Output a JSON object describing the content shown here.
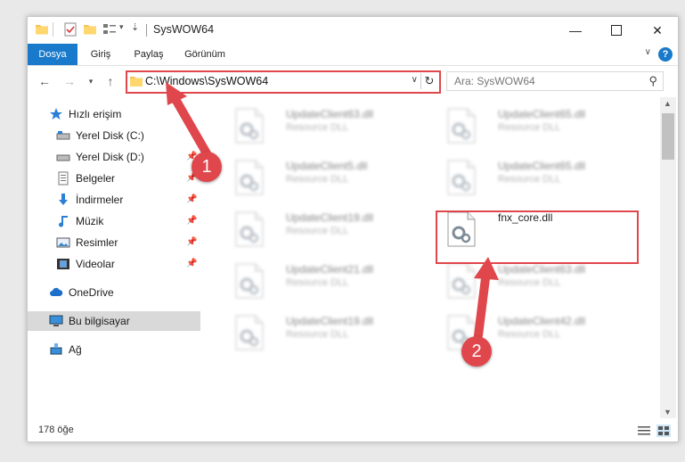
{
  "window": {
    "title": "SysWOW64"
  },
  "ribbon": {
    "tabs": [
      "Dosya",
      "Giriş",
      "Paylaş",
      "Görünüm"
    ],
    "help": "?"
  },
  "address": {
    "path": "C:\\Windows\\SysWOW64"
  },
  "search": {
    "placeholder": "Ara: SysWOW64"
  },
  "sidebar": {
    "items": [
      {
        "label": "Hızlı erişim",
        "icon": "star-icon"
      },
      {
        "label": "Yerel Disk (C:)",
        "icon": "drive-icon"
      },
      {
        "label": "Yerel Disk (D:)",
        "icon": "drive-icon"
      },
      {
        "label": "Belgeler",
        "icon": "documents-icon"
      },
      {
        "label": "İndirmeler",
        "icon": "download-icon"
      },
      {
        "label": "Müzik",
        "icon": "music-icon"
      },
      {
        "label": "Resimler",
        "icon": "pictures-icon"
      },
      {
        "label": "Videolar",
        "icon": "video-icon"
      },
      {
        "label": "OneDrive",
        "icon": "cloud-icon"
      },
      {
        "label": "Bu bilgisayar",
        "icon": "computer-icon"
      },
      {
        "label": "Ağ",
        "icon": "network-icon"
      }
    ]
  },
  "files": [
    {
      "name": "UpdateClient63.dll",
      "type": "Resource DLL"
    },
    {
      "name": "UpdateClient65.dll",
      "type": "Resource DLL"
    },
    {
      "name": "UpdateClient5.dll",
      "type": "Resource DLL"
    },
    {
      "name": "UpdateClient65.dll",
      "type": "Resource DLL"
    },
    {
      "name": "UpdateClient19.dll",
      "type": "Resource DLL"
    },
    {
      "name": "fnx_core.dll",
      "type": ""
    },
    {
      "name": "UpdateClient21.dll",
      "type": "Resource DLL"
    },
    {
      "name": "UpdateClient63.dll",
      "type": "Resource DLL"
    },
    {
      "name": "UpdateClient19.dll",
      "type": "Resource DLL"
    },
    {
      "name": "UpdateClient42.dll",
      "type": "Resource DLL"
    }
  ],
  "status": {
    "count": "178 öğe"
  },
  "annotations": {
    "step1": "1",
    "step2": "2"
  },
  "colors": {
    "accent": "#1979ca",
    "annotation": "#e0474c"
  }
}
